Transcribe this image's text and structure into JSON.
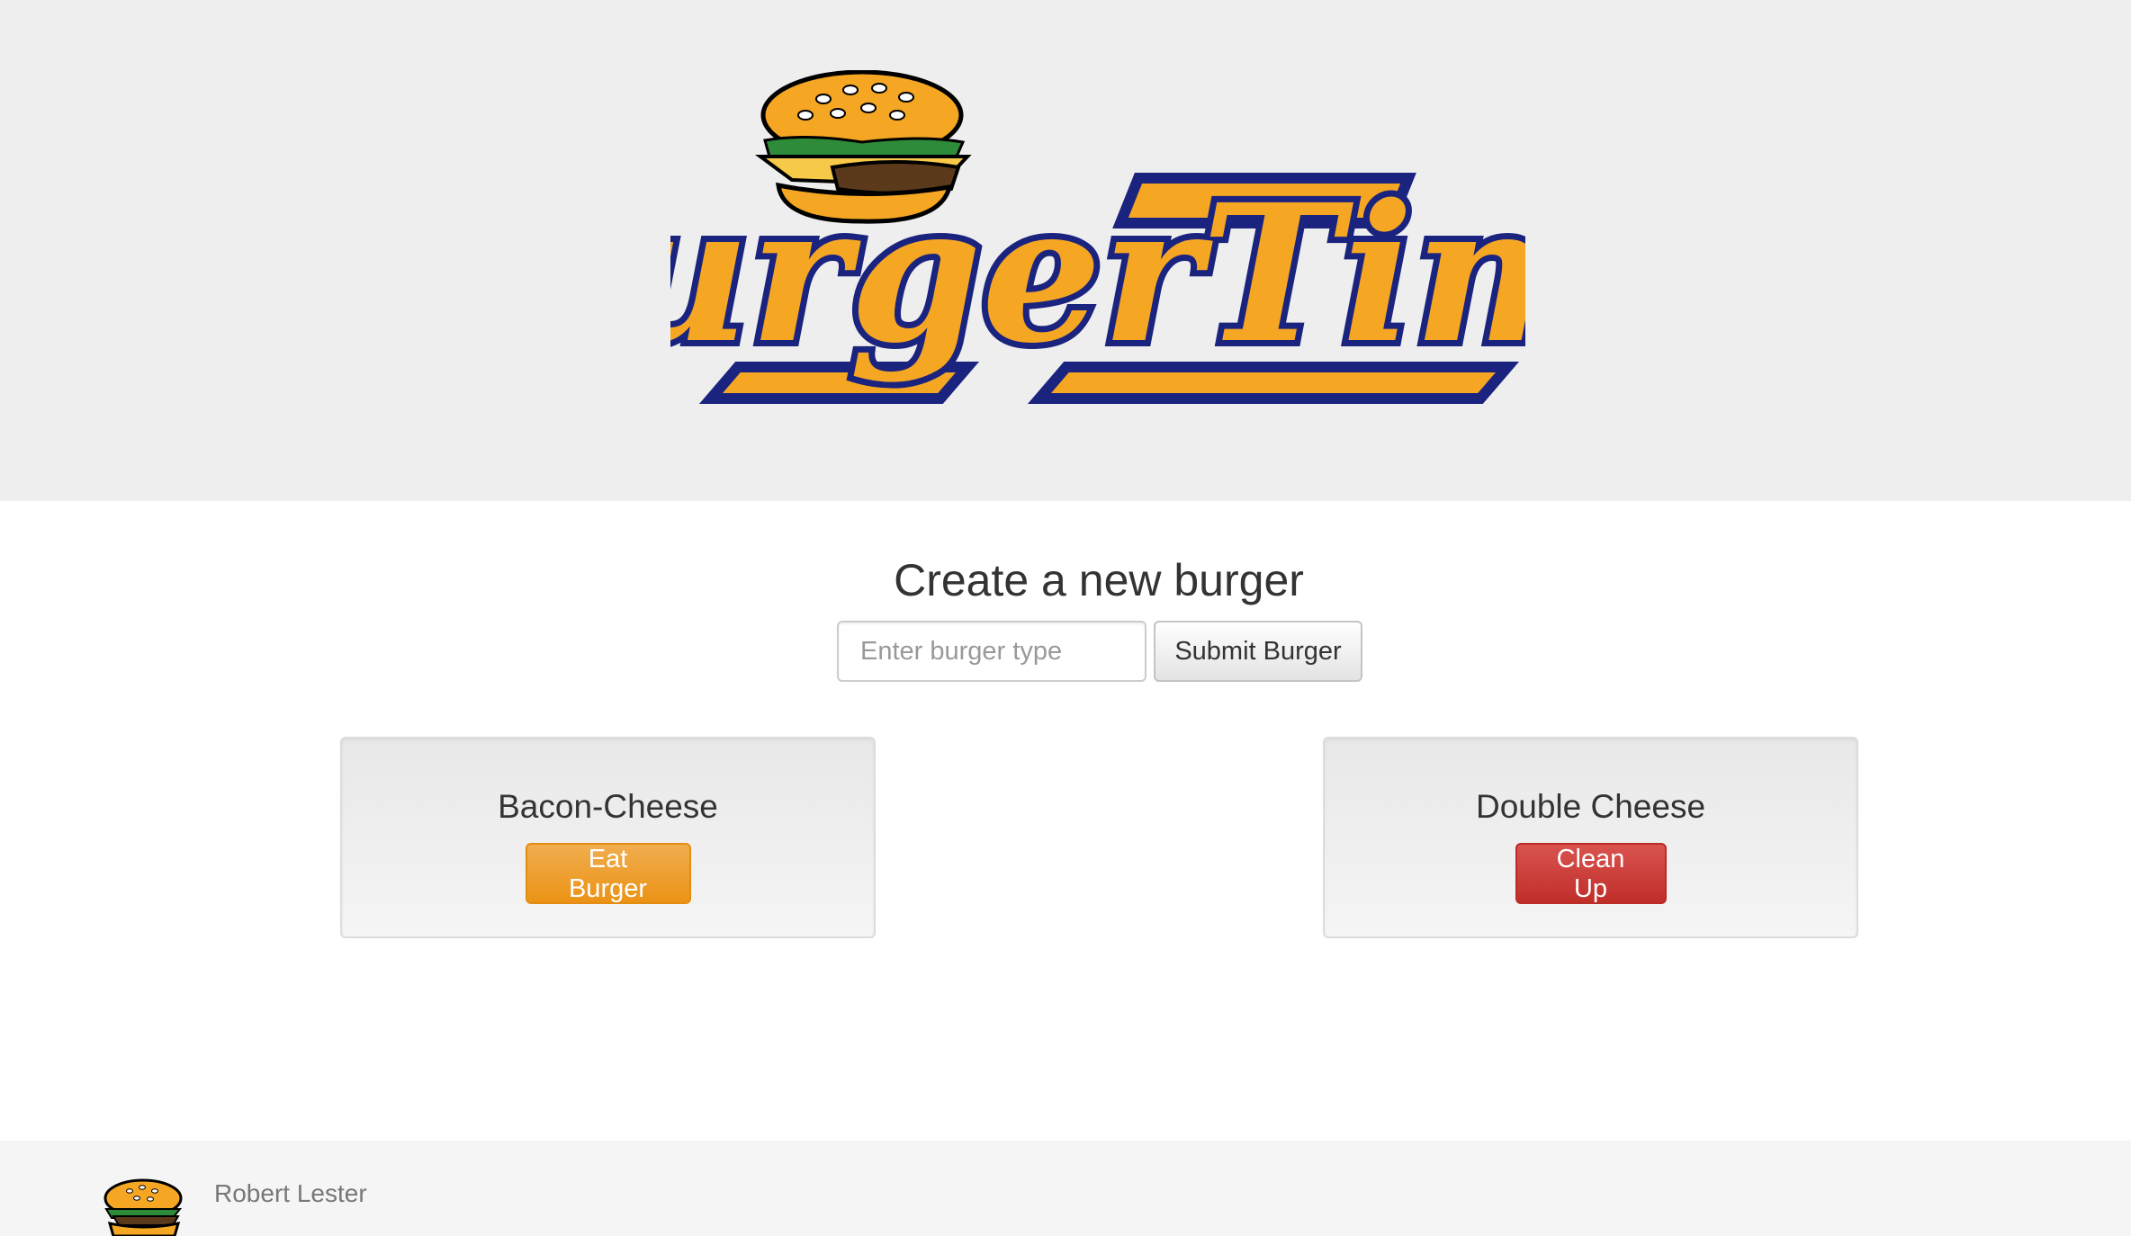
{
  "header": {
    "logo_text": "BurgerTime"
  },
  "form": {
    "title": "Create a new burger",
    "input_placeholder": "Enter burger type",
    "submit_label": "Submit Burger"
  },
  "burgers": [
    {
      "name": "Bacon-Cheese",
      "action_label": "Eat Burger",
      "status": "available"
    },
    {
      "name": "Double Cheese",
      "action_label": "Clean Up",
      "status": "devoured"
    }
  ],
  "footer": {
    "author": "Robert Lester"
  },
  "colors": {
    "jumbotron_bg": "#eeeeee",
    "logo_orange": "#f5a623",
    "logo_blue": "#1a237e",
    "eat_button": "#f0ad4e",
    "clean_button": "#d9534f"
  }
}
